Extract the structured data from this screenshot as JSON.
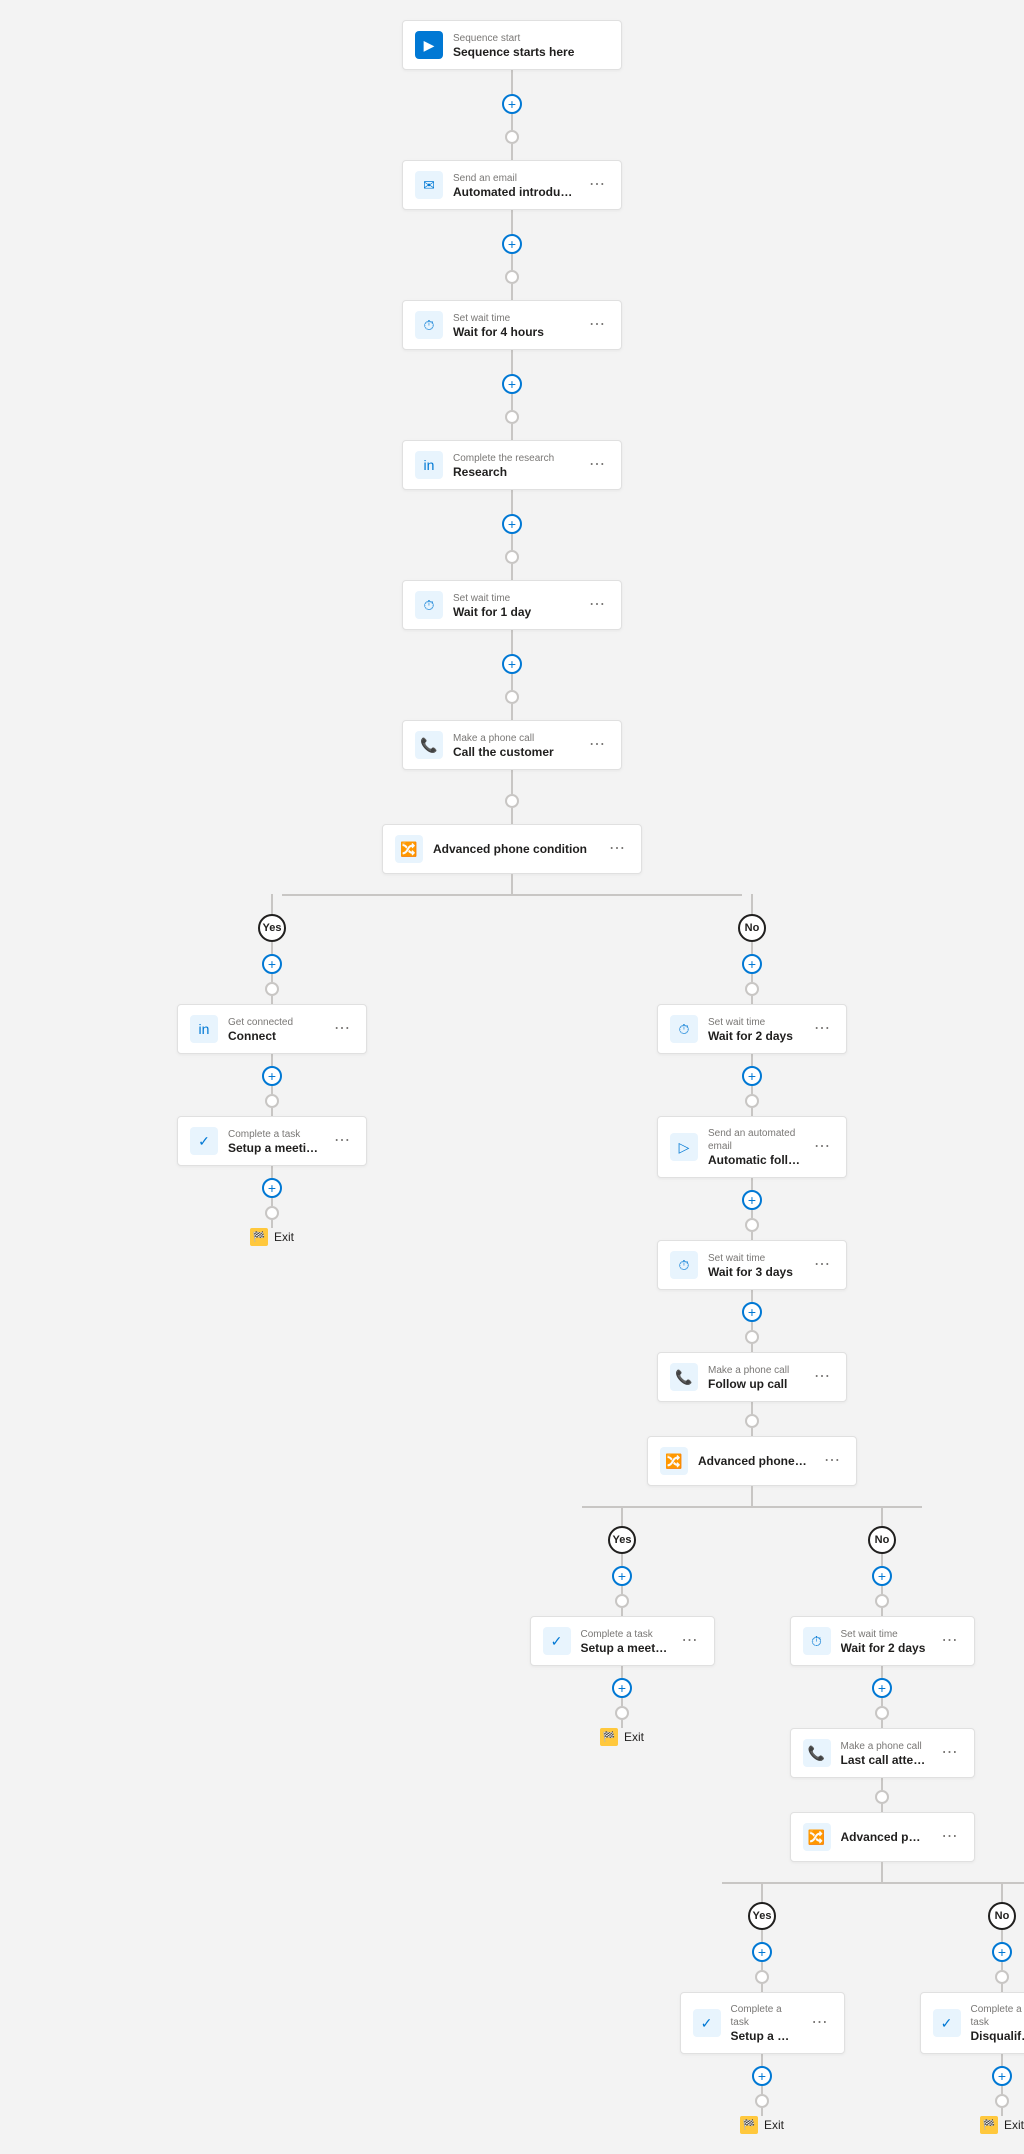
{
  "nodes": {
    "sequence_start": {
      "label": "Sequence start",
      "title": "Sequence starts here"
    },
    "send_email_1": {
      "label": "Send an email",
      "title": "Automated introductory email"
    },
    "wait_1": {
      "label": "Set wait time",
      "title": "Wait for 4 hours"
    },
    "research": {
      "label": "Complete the research",
      "title": "Research"
    },
    "wait_2": {
      "label": "Set wait time",
      "title": "Wait for 1 day"
    },
    "phone_call_1": {
      "label": "Make a phone call",
      "title": "Call the customer"
    },
    "condition_1": {
      "label": "Advanced phone condition"
    },
    "yes_1": "Yes",
    "no_1": "No",
    "connect": {
      "label": "Get connected",
      "title": "Connect"
    },
    "task_1": {
      "label": "Complete a task",
      "title": "Setup a meeting and move to the next s..."
    },
    "exit_1": "Exit",
    "wait_3": {
      "label": "Set wait time",
      "title": "Wait for 2 days"
    },
    "auto_email": {
      "label": "Send an automated email",
      "title": "Automatic follow up email"
    },
    "wait_4": {
      "label": "Set wait time",
      "title": "Wait for 3 days"
    },
    "phone_call_2": {
      "label": "Make a phone call",
      "title": "Follow up call"
    },
    "condition_2": {
      "label": "Advanced phone condition"
    },
    "yes_2": "Yes",
    "no_2": "No",
    "task_2": {
      "label": "Complete a task",
      "title": "Setup a meeting and move to the next s..."
    },
    "exit_2": "Exit",
    "wait_5": {
      "label": "Set wait time",
      "title": "Wait for 2 days"
    },
    "phone_call_3": {
      "label": "Make a phone call",
      "title": "Last call attempt"
    },
    "condition_3": {
      "label": "Advanced phone condition"
    },
    "yes_3": "Yes",
    "no_3": "No",
    "task_3": {
      "label": "Complete a task",
      "title": "Setup a meeting and move to the next s..."
    },
    "exit_3": "Exit",
    "task_4": {
      "label": "Complete a task",
      "title": "Disqualify the lead"
    },
    "exit_4": "Exit"
  }
}
